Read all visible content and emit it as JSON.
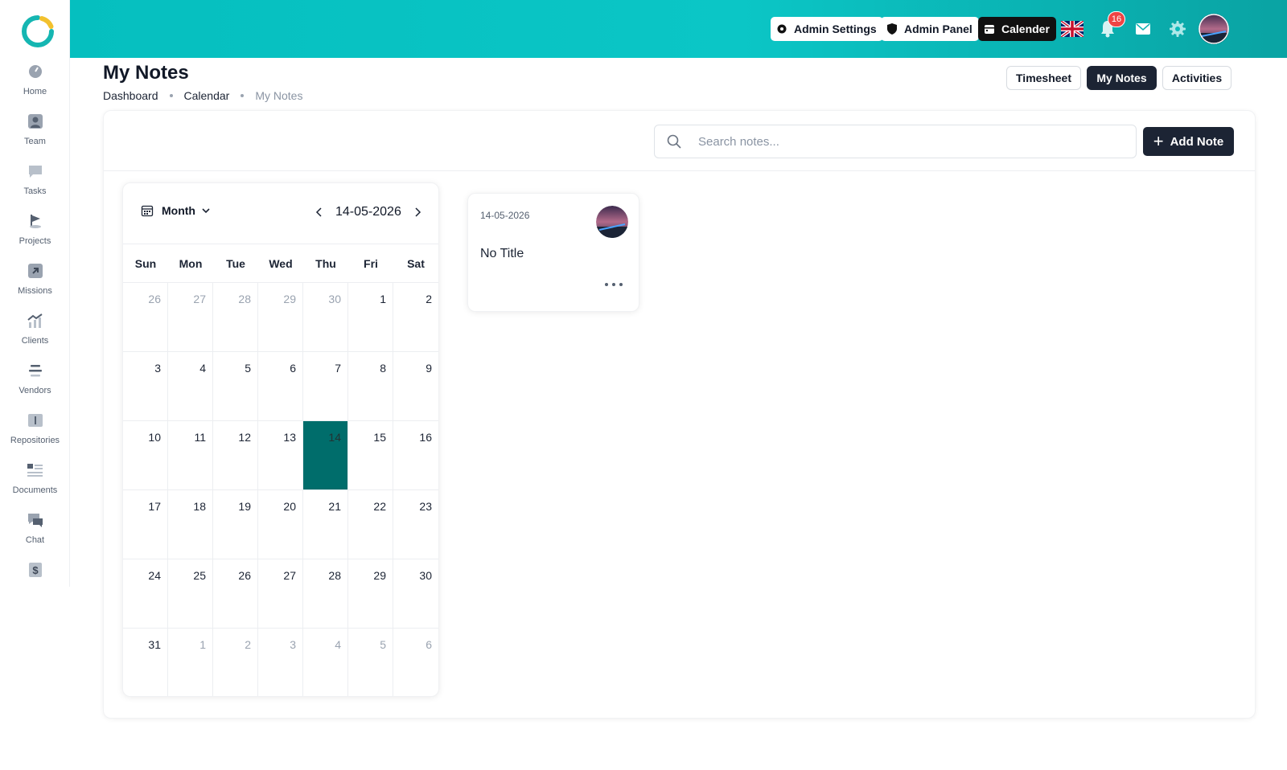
{
  "sidebar": {
    "items": [
      {
        "label": "Home",
        "icon": "dashboard-gauge-icon"
      },
      {
        "label": "Team",
        "icon": "user-icon"
      },
      {
        "label": "Tasks",
        "icon": "chat-board-icon"
      },
      {
        "label": "Projects",
        "icon": "flag-icon"
      },
      {
        "label": "Missions",
        "icon": "arrow-up-right-icon"
      },
      {
        "label": "Clients",
        "icon": "chart-growth-icon"
      },
      {
        "label": "Vendors",
        "icon": "lines-icon"
      },
      {
        "label": "Repositories",
        "icon": "folder-icon"
      },
      {
        "label": "Documents",
        "icon": "document-list-icon"
      },
      {
        "label": "Chat",
        "icon": "chat-icon"
      },
      {
        "label": "",
        "icon": "dollar-document-icon"
      }
    ]
  },
  "header": {
    "admin_settings": "Admin Settings",
    "admin_panel": "Admin Panel",
    "calender": "Calender",
    "notification_count": "16",
    "colors": {
      "gradient_start": "#05bfbf",
      "gradient_end": "#0aa3a3"
    }
  },
  "page": {
    "title": "My Notes",
    "breadcrumb": [
      "Dashboard",
      "Calendar",
      "My Notes"
    ],
    "tabs": [
      {
        "label": "Timesheet",
        "active": false
      },
      {
        "label": "My Notes",
        "active": true
      },
      {
        "label": "Activities",
        "active": false
      }
    ]
  },
  "toolbar": {
    "search_placeholder": "Search notes...",
    "add_label": "Add Note"
  },
  "calendar": {
    "view_label": "Month",
    "current_date": "14-05-2026",
    "weekdays": [
      "Sun",
      "Mon",
      "Tue",
      "Wed",
      "Thu",
      "Fri",
      "Sat"
    ],
    "today_color": "#006d6b",
    "weeks": [
      [
        {
          "d": "26",
          "m": true
        },
        {
          "d": "27",
          "m": true
        },
        {
          "d": "28",
          "m": true
        },
        {
          "d": "29",
          "m": true
        },
        {
          "d": "30",
          "m": true
        },
        {
          "d": "1"
        },
        {
          "d": "2"
        }
      ],
      [
        {
          "d": "3"
        },
        {
          "d": "4"
        },
        {
          "d": "5"
        },
        {
          "d": "6"
        },
        {
          "d": "7"
        },
        {
          "d": "8"
        },
        {
          "d": "9"
        }
      ],
      [
        {
          "d": "10"
        },
        {
          "d": "11"
        },
        {
          "d": "12"
        },
        {
          "d": "13"
        },
        {
          "d": "14",
          "today": true
        },
        {
          "d": "15"
        },
        {
          "d": "16"
        }
      ],
      [
        {
          "d": "17"
        },
        {
          "d": "18"
        },
        {
          "d": "19"
        },
        {
          "d": "20"
        },
        {
          "d": "21"
        },
        {
          "d": "22"
        },
        {
          "d": "23"
        }
      ],
      [
        {
          "d": "24"
        },
        {
          "d": "25"
        },
        {
          "d": "26"
        },
        {
          "d": "27"
        },
        {
          "d": "28"
        },
        {
          "d": "29"
        },
        {
          "d": "30"
        }
      ],
      [
        {
          "d": "31"
        },
        {
          "d": "1",
          "m": true
        },
        {
          "d": "2",
          "m": true
        },
        {
          "d": "3",
          "m": true
        },
        {
          "d": "4",
          "m": true
        },
        {
          "d": "5",
          "m": true
        },
        {
          "d": "6",
          "m": true
        }
      ]
    ]
  },
  "notes": [
    {
      "date": "14-05-2026",
      "title": "No Title"
    }
  ]
}
